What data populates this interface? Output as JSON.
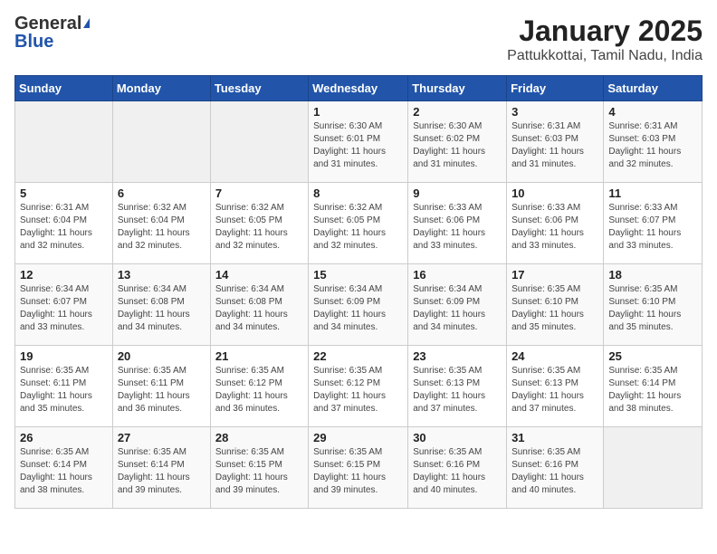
{
  "header": {
    "logo_general": "General",
    "logo_blue": "Blue",
    "title": "January 2025",
    "subtitle": "Pattukkottai, Tamil Nadu, India"
  },
  "calendar": {
    "days_of_week": [
      "Sunday",
      "Monday",
      "Tuesday",
      "Wednesday",
      "Thursday",
      "Friday",
      "Saturday"
    ],
    "weeks": [
      [
        {
          "day": "",
          "info": ""
        },
        {
          "day": "",
          "info": ""
        },
        {
          "day": "",
          "info": ""
        },
        {
          "day": "1",
          "info": "Sunrise: 6:30 AM\nSunset: 6:01 PM\nDaylight: 11 hours and 31 minutes."
        },
        {
          "day": "2",
          "info": "Sunrise: 6:30 AM\nSunset: 6:02 PM\nDaylight: 11 hours and 31 minutes."
        },
        {
          "day": "3",
          "info": "Sunrise: 6:31 AM\nSunset: 6:03 PM\nDaylight: 11 hours and 31 minutes."
        },
        {
          "day": "4",
          "info": "Sunrise: 6:31 AM\nSunset: 6:03 PM\nDaylight: 11 hours and 32 minutes."
        }
      ],
      [
        {
          "day": "5",
          "info": "Sunrise: 6:31 AM\nSunset: 6:04 PM\nDaylight: 11 hours and 32 minutes."
        },
        {
          "day": "6",
          "info": "Sunrise: 6:32 AM\nSunset: 6:04 PM\nDaylight: 11 hours and 32 minutes."
        },
        {
          "day": "7",
          "info": "Sunrise: 6:32 AM\nSunset: 6:05 PM\nDaylight: 11 hours and 32 minutes."
        },
        {
          "day": "8",
          "info": "Sunrise: 6:32 AM\nSunset: 6:05 PM\nDaylight: 11 hours and 32 minutes."
        },
        {
          "day": "9",
          "info": "Sunrise: 6:33 AM\nSunset: 6:06 PM\nDaylight: 11 hours and 33 minutes."
        },
        {
          "day": "10",
          "info": "Sunrise: 6:33 AM\nSunset: 6:06 PM\nDaylight: 11 hours and 33 minutes."
        },
        {
          "day": "11",
          "info": "Sunrise: 6:33 AM\nSunset: 6:07 PM\nDaylight: 11 hours and 33 minutes."
        }
      ],
      [
        {
          "day": "12",
          "info": "Sunrise: 6:34 AM\nSunset: 6:07 PM\nDaylight: 11 hours and 33 minutes."
        },
        {
          "day": "13",
          "info": "Sunrise: 6:34 AM\nSunset: 6:08 PM\nDaylight: 11 hours and 34 minutes."
        },
        {
          "day": "14",
          "info": "Sunrise: 6:34 AM\nSunset: 6:08 PM\nDaylight: 11 hours and 34 minutes."
        },
        {
          "day": "15",
          "info": "Sunrise: 6:34 AM\nSunset: 6:09 PM\nDaylight: 11 hours and 34 minutes."
        },
        {
          "day": "16",
          "info": "Sunrise: 6:34 AM\nSunset: 6:09 PM\nDaylight: 11 hours and 34 minutes."
        },
        {
          "day": "17",
          "info": "Sunrise: 6:35 AM\nSunset: 6:10 PM\nDaylight: 11 hours and 35 minutes."
        },
        {
          "day": "18",
          "info": "Sunrise: 6:35 AM\nSunset: 6:10 PM\nDaylight: 11 hours and 35 minutes."
        }
      ],
      [
        {
          "day": "19",
          "info": "Sunrise: 6:35 AM\nSunset: 6:11 PM\nDaylight: 11 hours and 35 minutes."
        },
        {
          "day": "20",
          "info": "Sunrise: 6:35 AM\nSunset: 6:11 PM\nDaylight: 11 hours and 36 minutes."
        },
        {
          "day": "21",
          "info": "Sunrise: 6:35 AM\nSunset: 6:12 PM\nDaylight: 11 hours and 36 minutes."
        },
        {
          "day": "22",
          "info": "Sunrise: 6:35 AM\nSunset: 6:12 PM\nDaylight: 11 hours and 37 minutes."
        },
        {
          "day": "23",
          "info": "Sunrise: 6:35 AM\nSunset: 6:13 PM\nDaylight: 11 hours and 37 minutes."
        },
        {
          "day": "24",
          "info": "Sunrise: 6:35 AM\nSunset: 6:13 PM\nDaylight: 11 hours and 37 minutes."
        },
        {
          "day": "25",
          "info": "Sunrise: 6:35 AM\nSunset: 6:14 PM\nDaylight: 11 hours and 38 minutes."
        }
      ],
      [
        {
          "day": "26",
          "info": "Sunrise: 6:35 AM\nSunset: 6:14 PM\nDaylight: 11 hours and 38 minutes."
        },
        {
          "day": "27",
          "info": "Sunrise: 6:35 AM\nSunset: 6:14 PM\nDaylight: 11 hours and 39 minutes."
        },
        {
          "day": "28",
          "info": "Sunrise: 6:35 AM\nSunset: 6:15 PM\nDaylight: 11 hours and 39 minutes."
        },
        {
          "day": "29",
          "info": "Sunrise: 6:35 AM\nSunset: 6:15 PM\nDaylight: 11 hours and 39 minutes."
        },
        {
          "day": "30",
          "info": "Sunrise: 6:35 AM\nSunset: 6:16 PM\nDaylight: 11 hours and 40 minutes."
        },
        {
          "day": "31",
          "info": "Sunrise: 6:35 AM\nSunset: 6:16 PM\nDaylight: 11 hours and 40 minutes."
        },
        {
          "day": "",
          "info": ""
        }
      ]
    ]
  }
}
